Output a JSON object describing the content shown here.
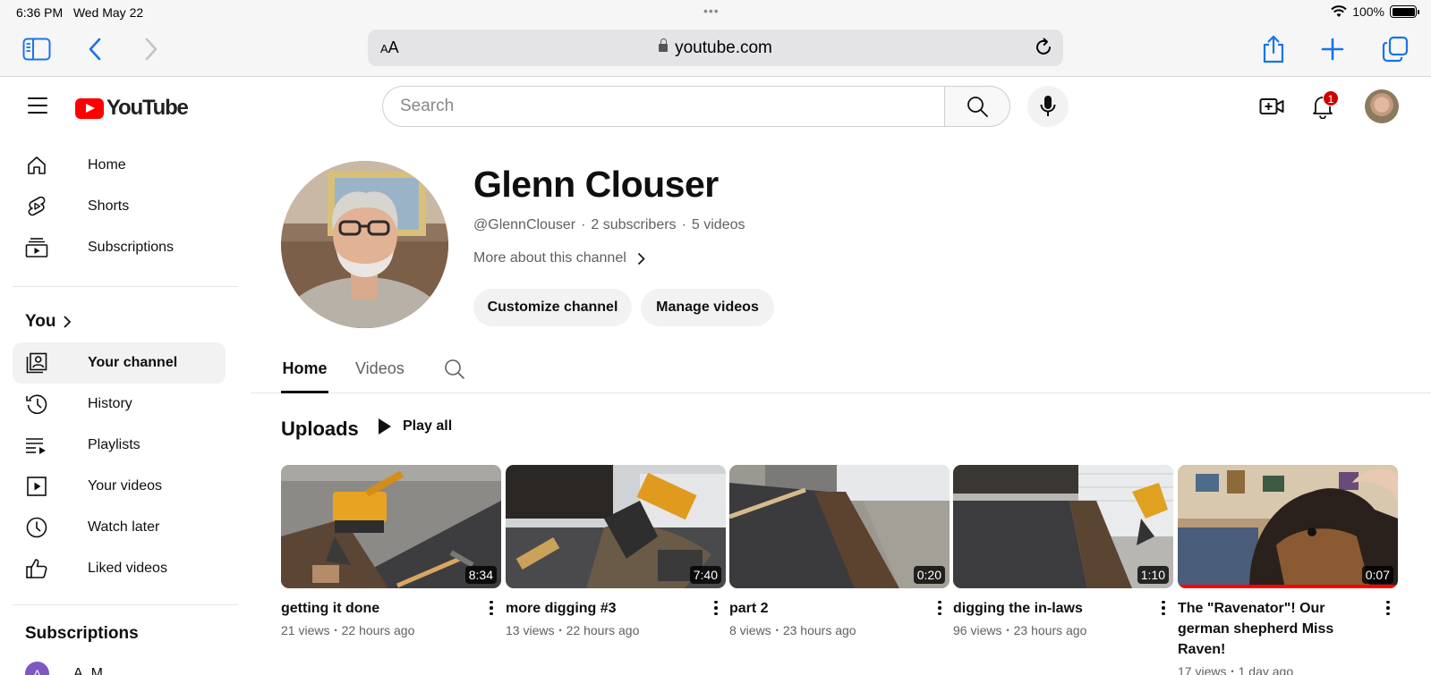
{
  "status_bar": {
    "time": "6:36 PM",
    "date": "Wed May 22",
    "battery": "100%"
  },
  "browser": {
    "url": "youtube.com",
    "aa_label": "AA"
  },
  "header": {
    "search_placeholder": "Search",
    "notification_count": "1"
  },
  "sidebar": {
    "items": [
      {
        "label": "Home"
      },
      {
        "label": "Shorts"
      },
      {
        "label": "Subscriptions"
      }
    ],
    "you_label": "You",
    "you_items": [
      {
        "label": "Your channel"
      },
      {
        "label": "History"
      },
      {
        "label": "Playlists"
      },
      {
        "label": "Your videos"
      },
      {
        "label": "Watch later"
      },
      {
        "label": "Liked videos"
      }
    ],
    "subscriptions_label": "Subscriptions",
    "subscriptions": [
      {
        "initial": "A",
        "name": "A_M"
      }
    ]
  },
  "channel": {
    "name": "Glenn Clouser",
    "handle": "@GlennClouser",
    "subscribers": "2 subscribers",
    "videos_count": "5 videos",
    "more_about": "More about this channel",
    "customize_label": "Customize channel",
    "manage_label": "Manage videos"
  },
  "tabs": [
    {
      "label": "Home"
    },
    {
      "label": "Videos"
    }
  ],
  "uploads": {
    "title": "Uploads",
    "play_all": "Play all",
    "videos": [
      {
        "title": "getting it done",
        "duration": "8:34",
        "views": "21 views",
        "age": "22 hours ago"
      },
      {
        "title": "more digging #3",
        "duration": "7:40",
        "views": "13 views",
        "age": "22 hours ago"
      },
      {
        "title": "part 2",
        "duration": "0:20",
        "views": "8 views",
        "age": "23 hours ago"
      },
      {
        "title": "digging the in-laws",
        "duration": "1:10",
        "views": "96 views",
        "age": "23 hours ago"
      },
      {
        "title": "The \"Ravenator\"! Our german shepherd Miss Raven!",
        "duration": "0:07",
        "views": "17 views",
        "age": "1 day ago",
        "watch_progress": 1.0
      }
    ]
  },
  "colors": {
    "brand_red": "#ff0000",
    "safari_blue": "#1a73e8",
    "text_secondary": "#606060"
  }
}
